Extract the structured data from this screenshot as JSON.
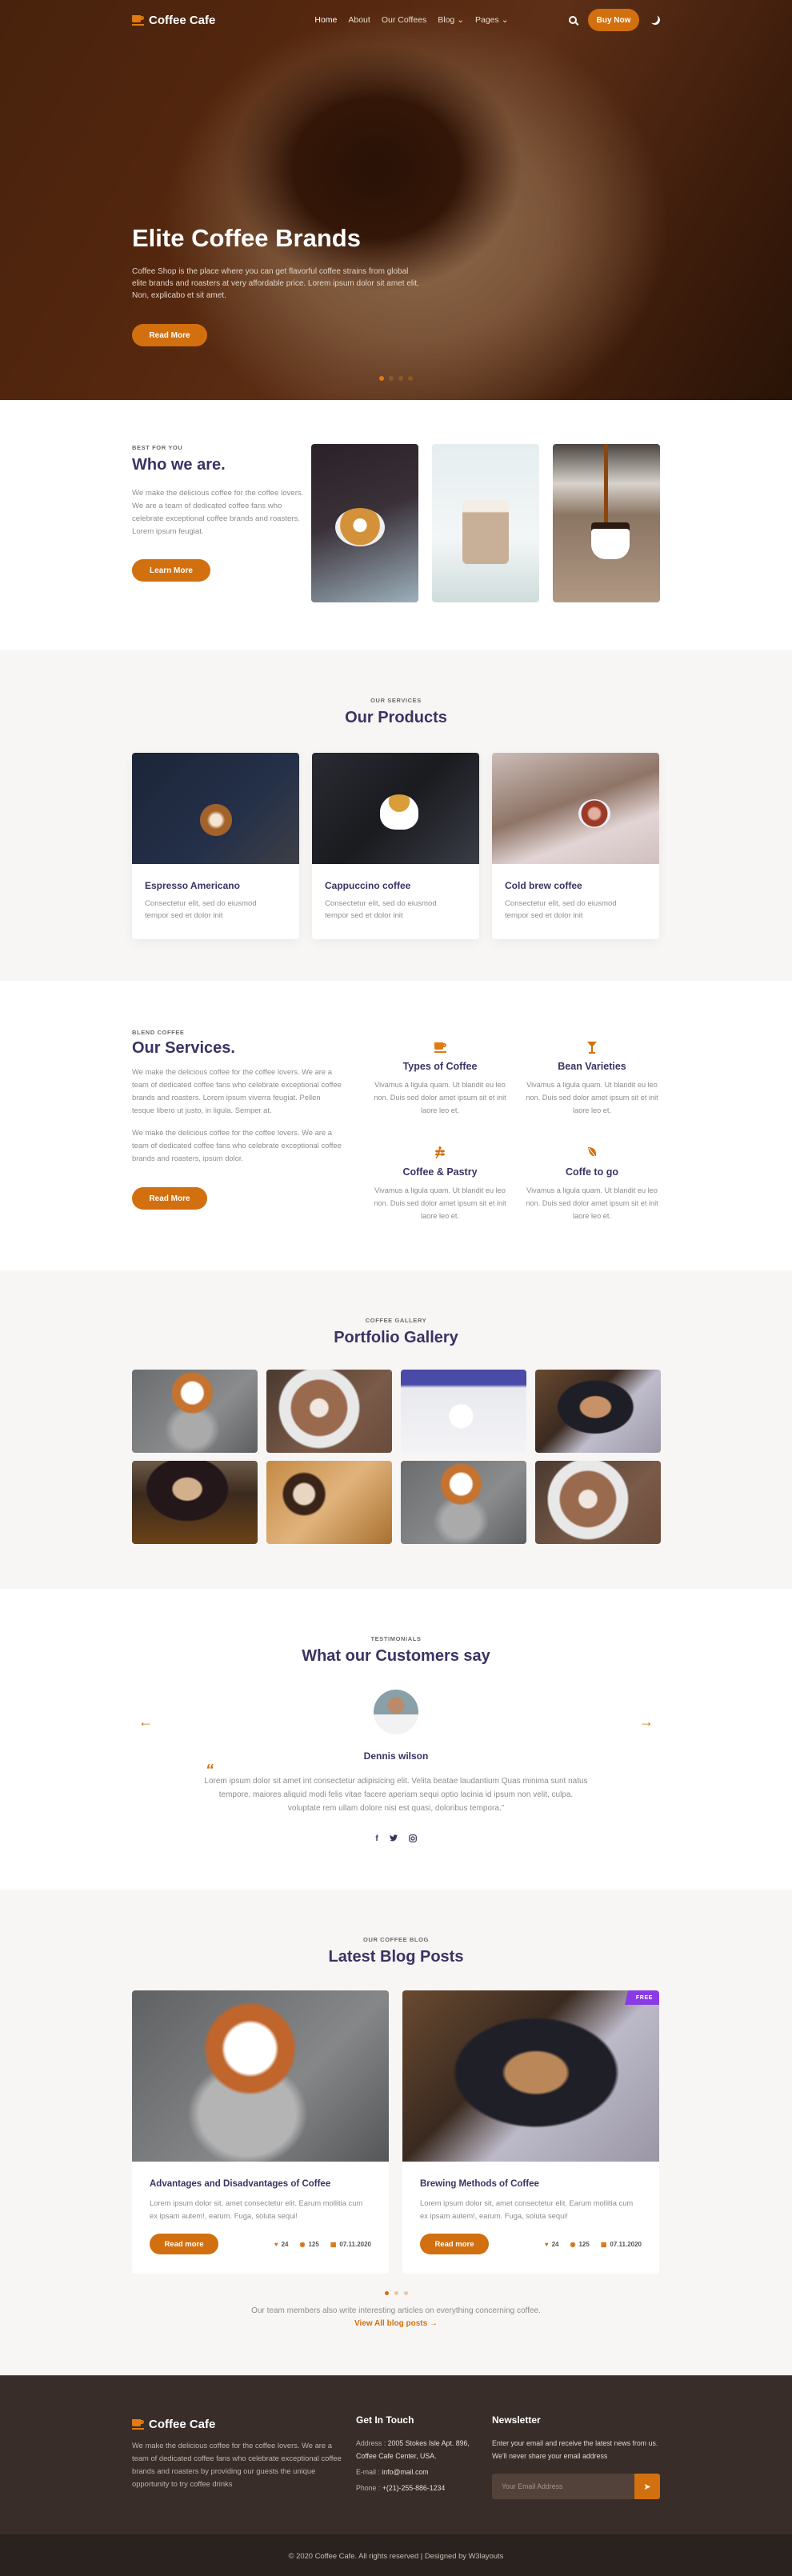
{
  "brand": {
    "name": "Coffee Cafe",
    "accent": "#d2700f",
    "heading_color": "#3b3363"
  },
  "nav": {
    "items": [
      {
        "label": "Home",
        "active": true
      },
      {
        "label": "About"
      },
      {
        "label": "Our Coffees"
      },
      {
        "label": "Blog",
        "dropdown": true
      },
      {
        "label": "Pages",
        "dropdown": true
      }
    ],
    "buy_label": "Buy Now",
    "icons": [
      "search-icon",
      "moon-icon"
    ]
  },
  "hero": {
    "title": "Elite Coffee Brands",
    "text": "Coffee Shop is the place where you can get flavorful coffee strains from global elite brands and roasters at very affordable price. Lorem ipsum dolor sit amet elit. Non, explicabo et sit amet.",
    "button": "Read More",
    "slides": 4,
    "active_slide": 1
  },
  "who": {
    "label": "Best for you",
    "title": "Who we are.",
    "text": "We make the delicious coffee for the coffee lovers. We are a team of dedicated coffee fans who celebrate exceptional coffee brands and roasters. Lorem ipsum feugiat.",
    "button": "Learn More"
  },
  "products": {
    "label": "Our Services",
    "title": "Our Products",
    "items": [
      {
        "title": "Espresso Americano",
        "text": "Consectetur elit, sed do eiusmod tempor sed et dolor init"
      },
      {
        "title": "Cappuccino coffee",
        "text": "Consectetur elit, sed do eiusmod tempor sed et dolor init"
      },
      {
        "title": "Cold brew coffee",
        "text": "Consectetur elit, sed do eiusmod tempor sed et dolor init"
      }
    ]
  },
  "services": {
    "label": "Blend Coffee",
    "title": "Our Services.",
    "para1": "We make the delicious coffee for the coffee lovers. We are a team of dedicated coffee fans who celebrate exceptional coffee brands and roasters. Lorem ipsum viverra feugiat. Pellen tesque libero ut justo, in ligula. Semper at.",
    "para2": "We make the delicious coffee for the coffee lovers. We are a team of dedicated coffee fans who celebrate exceptional coffee brands and roasters, ipsum dolor.",
    "button": "Read More",
    "items": [
      {
        "icon": "coffee-cup-icon",
        "glyph": "☕",
        "title": "Types of Coffee",
        "text": "Vivamus a ligula quam. Ut blandit eu leo non. Duis sed dolor amet ipsum sit et init laore leo et."
      },
      {
        "icon": "cocktail-glass-icon",
        "glyph": "🍸",
        "title": "Bean Varieties",
        "text": "Vivamus a ligula quam. Ut blandit eu leo non. Duis sed dolor amet ipsum sit et init laore leo et."
      },
      {
        "icon": "seedling-icon",
        "glyph": "❦",
        "title": "Coffee & Pastry",
        "text": "Vivamus a ligula quam. Ut blandit eu leo non. Duis sed dolor amet ipsum sit et init laore leo et."
      },
      {
        "icon": "leaf-icon",
        "glyph": "🍂",
        "title": "Coffe to go",
        "text": "Vivamus a ligula quam. Ut blandit eu leo non. Duis sed dolor amet ipsum sit et init laore leo et."
      }
    ]
  },
  "gallery": {
    "label": "Coffee Gallery",
    "title": "Portfolio Gallery",
    "count": 8
  },
  "testimonials": {
    "label": "Testimonials",
    "title": "What our Customers say",
    "name": "Dennis wilson",
    "quote_mark": "“",
    "text": "Lorem ipsum dolor sit amet int consectetur adipisicing elit. Velita beatae laudantium Quas minima sunt natus tempore, maiores aliquid modi felis vitae facere aperiam sequi optio lacinia id ipsum non velit, culpa. voluptate rem ullam dolore nisi est quasi, doloribus tempora.”",
    "prev": "←",
    "next": "→",
    "socials": [
      {
        "icon": "facebook-icon",
        "glyph": "f"
      },
      {
        "icon": "twitter-icon",
        "glyph": "🐦"
      },
      {
        "icon": "instagram-icon",
        "glyph": "◎"
      }
    ]
  },
  "blog": {
    "label": "Our Coffee Blog",
    "title": "Latest Blog Posts",
    "posts": [
      {
        "title": "Advantages and Disadvantages of Coffee",
        "text": "Lorem ipsum dolor sit, amet consectetur elit. Earum mollitia cum ex ipsam autem!, earum. Fuga, soluta sequi!",
        "button": "Read more",
        "likes": "24",
        "views": "125",
        "date": "07.11.2020"
      },
      {
        "title": "Brewing Methods of Coffee",
        "text": "Lorem ipsum dolor sit, amet consectetur elit. Earum mollitia cum ex ipsam autem!, earum. Fuga, soluta sequi!",
        "button": "Read more",
        "likes": "24",
        "views": "125",
        "date": "07.11.2020",
        "badge": "FREE"
      }
    ],
    "pages": 3,
    "active_page": 1,
    "note": "Our team members also write interesting articles on everything concerning coffee.",
    "link": "View All blog posts →"
  },
  "footer": {
    "about": "We make the delicious coffee for the coffee lovers. We are a team of dedicated coffee fans who celebrate exceptional coffee brands and roasters by providing our guests the unique opportunity to try coffee drinks",
    "contact_title": "Get In Touch",
    "address_label": "Address :",
    "address": "2005 Stokes Isle Apt. 896, Coffee Cafe Center, USA.",
    "email_label": "E-mail :",
    "email": "info@mail.com",
    "phone_label": "Phone :",
    "phone": "+(21)-255-886-1234",
    "newsletter_title": "Newsletter",
    "newsletter_text": "Enter your email and receive the latest news from us. We'll never share your email address",
    "email_placeholder": "Your Email Address",
    "copyright": "© 2020 Coffee Cafe. All rights reserved | Designed by W3layouts"
  }
}
